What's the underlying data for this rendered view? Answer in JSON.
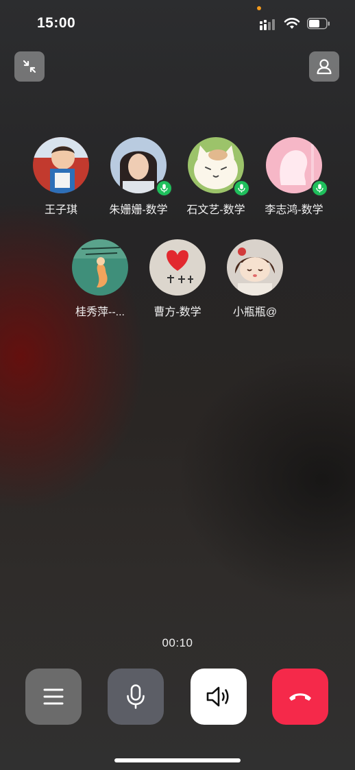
{
  "status_bar": {
    "time": "15:00",
    "icons": [
      "signal-icon",
      "wifi-icon",
      "battery-icon"
    ],
    "indicator_color": "#f39a1c"
  },
  "header": {
    "left_button_icon": "minimize-arrows-icon",
    "right_button_icon": "person-icon"
  },
  "participants": [
    {
      "name": "王子琪",
      "speaking": false,
      "avatar": "child-photo"
    },
    {
      "name": "朱姗姗-数学",
      "speaking": true,
      "avatar": "woman-photo"
    },
    {
      "name": "石文艺-数学",
      "speaking": true,
      "avatar": "cat-cartoon"
    },
    {
      "name": "李志鸿-数学",
      "speaking": true,
      "avatar": "pink-silhouette"
    },
    {
      "name": "桂秀萍--...",
      "speaking": false,
      "avatar": "mermaid-drawing"
    },
    {
      "name": "曹方-数学",
      "speaking": false,
      "avatar": "heart-drawing"
    },
    {
      "name": "小瓶瓶@",
      "speaking": false,
      "avatar": "girl-cartoon"
    }
  ],
  "call": {
    "timer": "00:10"
  },
  "controls": [
    {
      "name": "menu",
      "icon": "menu-icon"
    },
    {
      "name": "microphone",
      "icon": "microphone-icon"
    },
    {
      "name": "speaker",
      "icon": "speaker-icon"
    },
    {
      "name": "hang-up",
      "icon": "hang-up-icon"
    }
  ],
  "colors": {
    "speaking_badge": "#1fbf5c",
    "hang_up": "#f5294a",
    "speaker_active": "#ffffff"
  }
}
